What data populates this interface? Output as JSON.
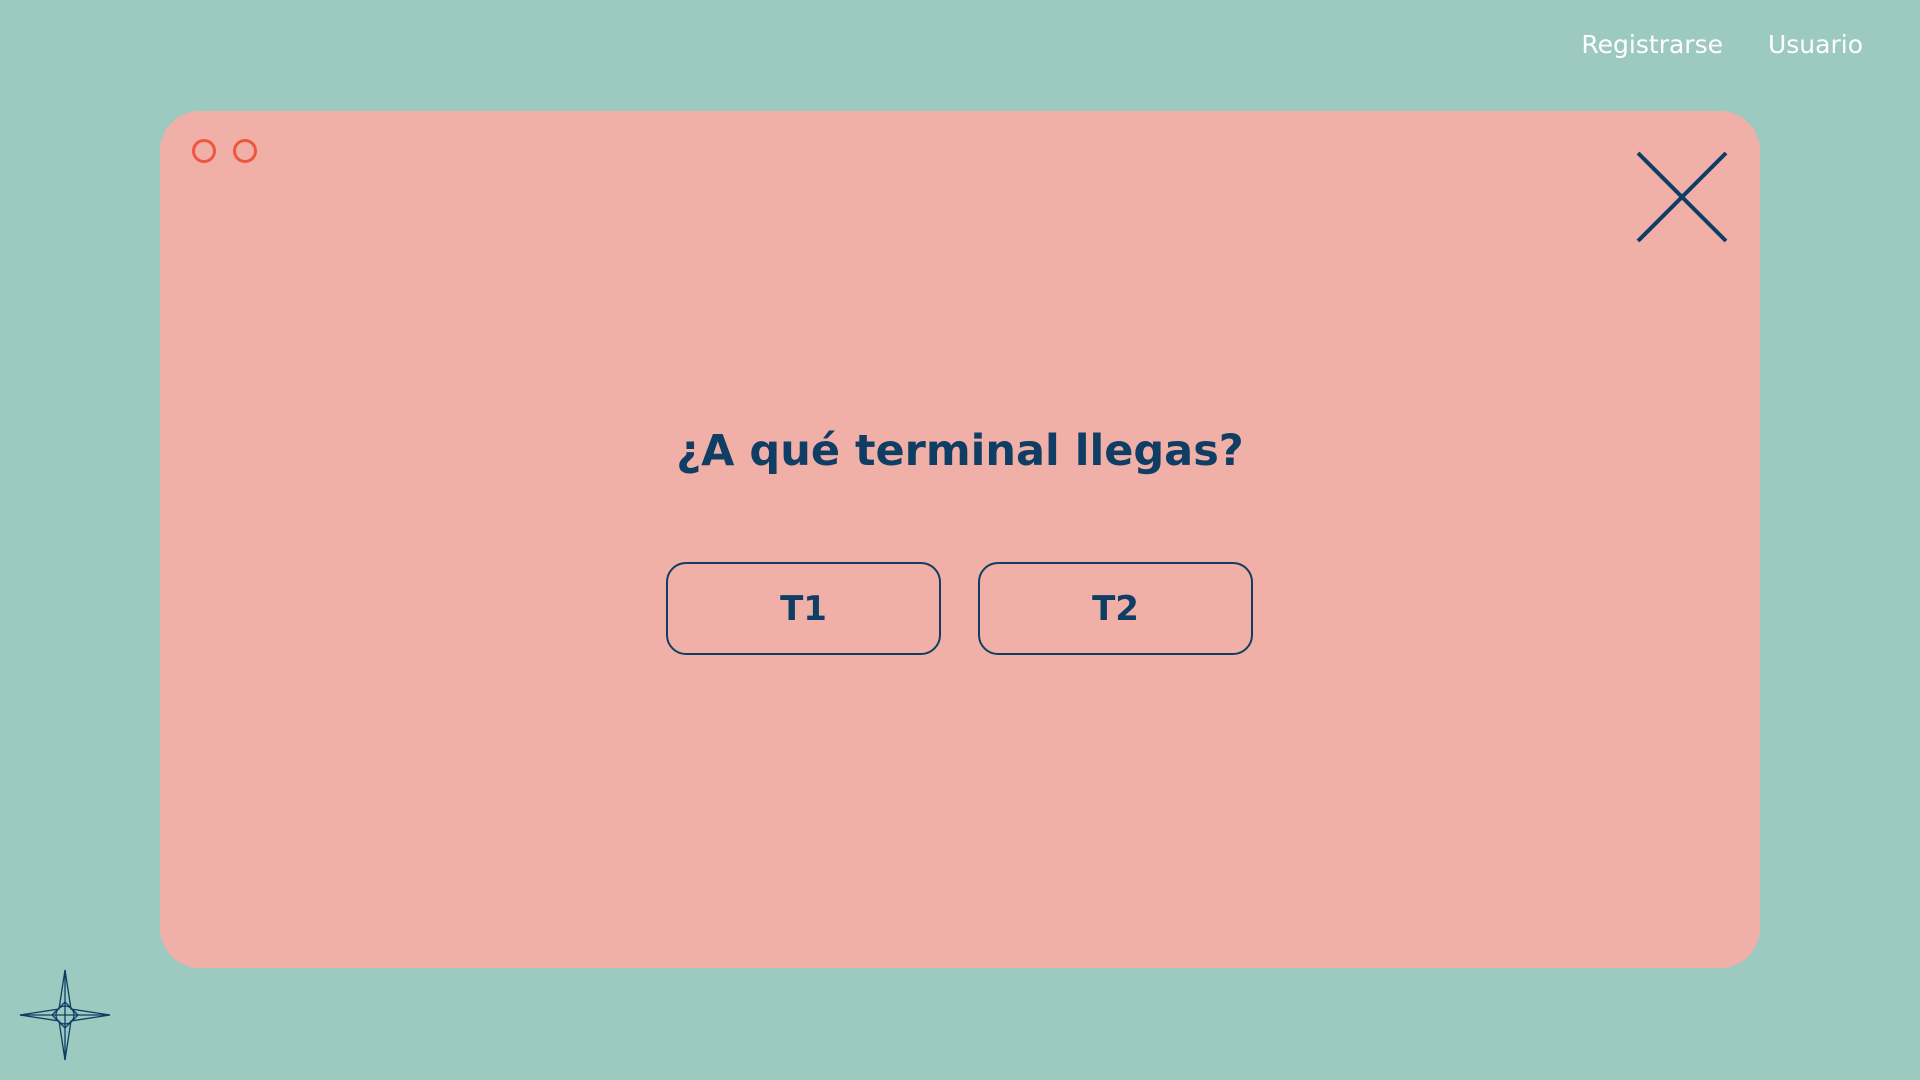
{
  "nav": {
    "register_label": "Registrarse",
    "user_label": "Usuario"
  },
  "modal": {
    "question": "¿A qué terminal llegas?",
    "options": [
      "T1",
      "T2"
    ],
    "close_icon": "close-icon",
    "window_dot_icons": [
      "circle-icon",
      "circle-icon"
    ]
  },
  "decoration": {
    "compass_icon": "compass-star-icon"
  },
  "colors": {
    "background": "#9ccac0",
    "modal": "#f0b0a8",
    "accent": "#f0563d",
    "text": "#0f3d63",
    "nav_text": "#ffffff"
  }
}
